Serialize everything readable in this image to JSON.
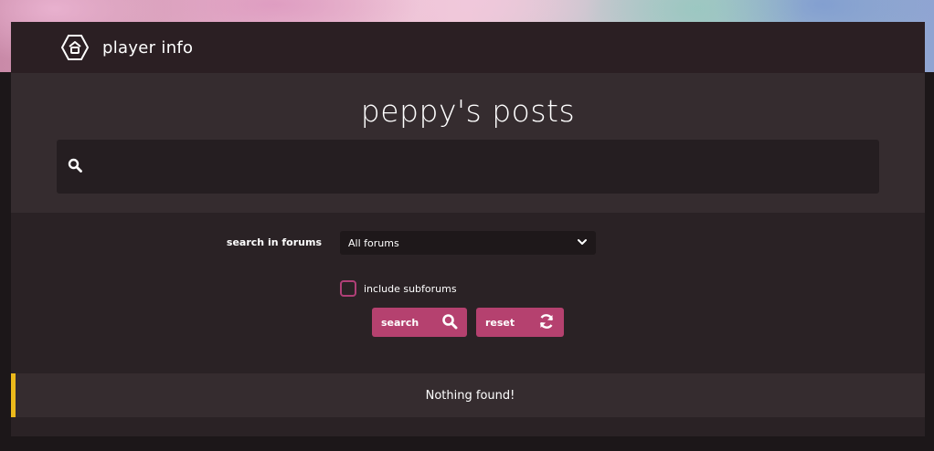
{
  "header": {
    "title": "player info",
    "logo_icon": "hexagon-home-icon"
  },
  "hero": {
    "title": "peppy's posts",
    "search": {
      "icon": "search-icon",
      "value": "",
      "placeholder": ""
    }
  },
  "form": {
    "forum_label": "search in forums",
    "forum_select": {
      "selected": "All forums",
      "icon": "chevron-down-icon"
    },
    "subforums_label": "include subforums",
    "subforums_checked": false,
    "search_button": {
      "label": "search",
      "icon": "search-icon"
    },
    "reset_button": {
      "label": "reset",
      "icon": "refresh-icon"
    }
  },
  "notice": {
    "text": "Nothing found!"
  },
  "colors": {
    "accent": "#b5416f",
    "notice_bar": "#ecb91b",
    "header_bg": "#2b1f23",
    "hero_bg": "#352c2f"
  }
}
